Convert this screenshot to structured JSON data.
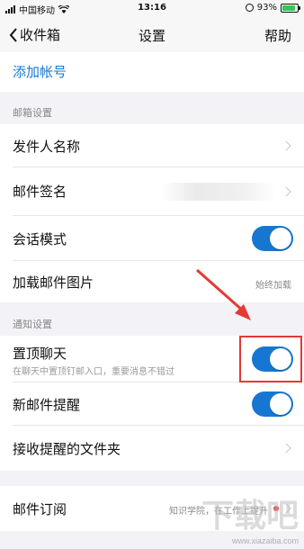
{
  "status_bar": {
    "carrier": "中国移动",
    "time": "13:16",
    "battery_percent": "93%"
  },
  "nav": {
    "back_label": "收件箱",
    "title": "设置",
    "help_label": "帮助"
  },
  "add_account": "添加帐号",
  "mailbox_section": {
    "header": "邮箱设置",
    "sender_name": "发件人名称",
    "signature": "邮件签名",
    "conversation_mode": "会话模式",
    "load_images": "加载邮件图片",
    "load_images_value": "始终加载"
  },
  "notify_section": {
    "header": "通知设置",
    "pin_chat": "置顶聊天",
    "pin_chat_sub": "在聊天中置顶钉邮入口，重要消息不错过",
    "new_mail_alert": "新邮件提醒",
    "alert_folders": "接收提醒的文件夹"
  },
  "subscription": {
    "label": "邮件订阅",
    "value": "知识学院，在工作上提升"
  },
  "watermark": "www.xiazaiba.com",
  "colors": {
    "accent": "#1677d2",
    "highlight": "#e53935"
  }
}
